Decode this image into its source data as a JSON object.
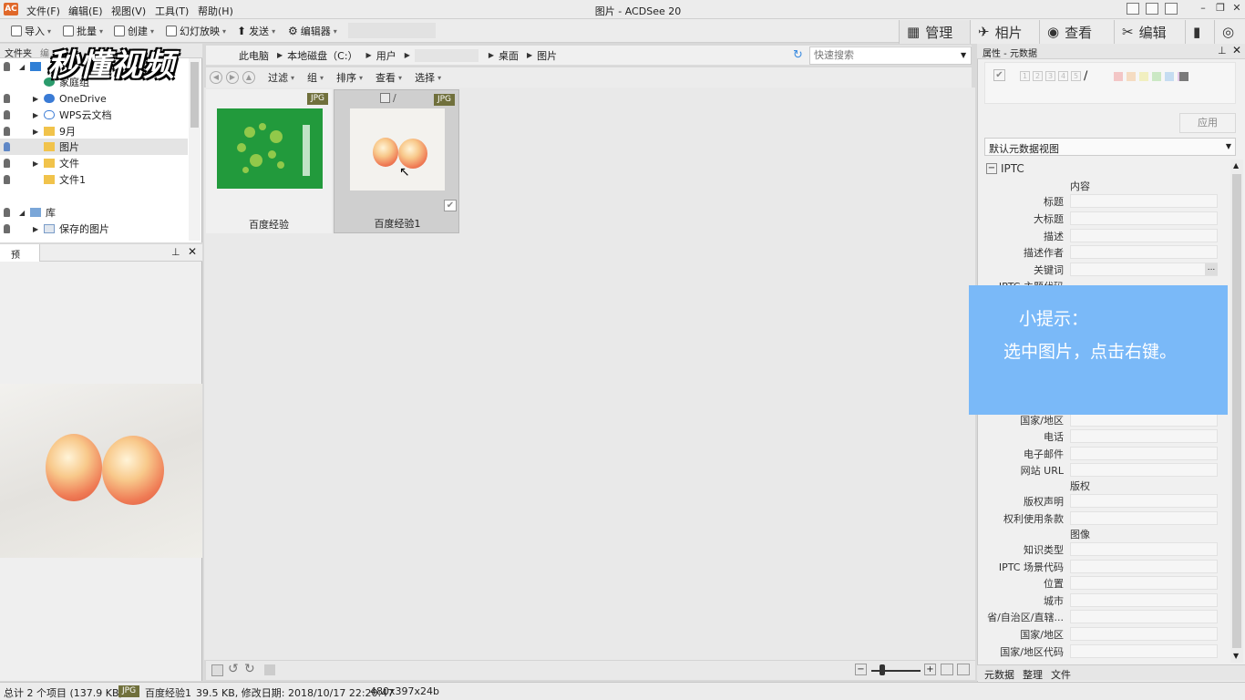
{
  "window": {
    "title": "图片 - ACDSee 20",
    "app_icon": "acdsee-logo"
  },
  "menu": [
    "文件(F)",
    "编辑(E)",
    "视图(V)",
    "工具(T)",
    "帮助(H)"
  ],
  "toolbar": {
    "import": "导入",
    "batch": "批量",
    "create": "创建",
    "slideshow": "幻灯放映",
    "send": "发送",
    "editor": "编辑器"
  },
  "modes": {
    "manage": "管理",
    "photos": "相片",
    "view": "查看",
    "edit": "编辑"
  },
  "folders_panel": {
    "tab_folders": "文件夹",
    "tab_other": "编",
    "items": [
      "家庭组",
      "OneDrive",
      "WPS云文档",
      "9月",
      "图片",
      "文件",
      "文件1",
      "库",
      "保存的图片"
    ]
  },
  "preview_panel": {
    "title": "预览"
  },
  "path": {
    "crumbs": [
      "此电脑",
      "本地磁盘（C:）",
      "用户",
      "桌面",
      "图片"
    ]
  },
  "search": {
    "placeholder": "快速搜索"
  },
  "filterbar": [
    "过滤",
    "组",
    "排序",
    "查看",
    "选择"
  ],
  "files": [
    {
      "name": "百度经验",
      "type": "JPG"
    },
    {
      "name": "百度经验1",
      "type": "JPG"
    }
  ],
  "properties": {
    "title": "属性 - 元数据",
    "ratings": [
      "1",
      "2",
      "3",
      "4",
      "5"
    ],
    "color_labels": [
      "#f3c6c6",
      "#f5dcc2",
      "#f1efc0",
      "#cbe8c4",
      "#c5dcf1",
      "#e5c9ea",
      "#7a7a7a"
    ],
    "apply": "应用",
    "metadata_view": "默认元数据视图",
    "section_iptc": "IPTC",
    "group_content": "内容",
    "fields_top": [
      "标题",
      "大标题",
      "描述",
      "描述作者",
      "关键词",
      "IPTC 主题代码"
    ],
    "fields_contact": [
      "国家/地区",
      "电话",
      "电子邮件",
      "网站 URL"
    ],
    "group_copyright": "版权",
    "fields_copyright": [
      "版权声明",
      "权利使用条款"
    ],
    "group_image": "图像",
    "fields_image": [
      "知识类型",
      "IPTC 场景代码",
      "位置",
      "城市",
      "省/自治区/直辖...",
      "国家/地区",
      "国家/地区代码"
    ],
    "tabs": [
      "元数据",
      "整理",
      "文件"
    ]
  },
  "tip": {
    "heading": "小提示：",
    "text": "选中图片，点击右键。"
  },
  "status": {
    "total": "总计 2 个项目 (137.9 KB)",
    "type": "JPG",
    "filename": "百度经验1",
    "info": "39.5 KB, 修改日期: 2018/10/17 22:20:47",
    "dims": "480x397x24b"
  },
  "watermark": "秒懂视频"
}
